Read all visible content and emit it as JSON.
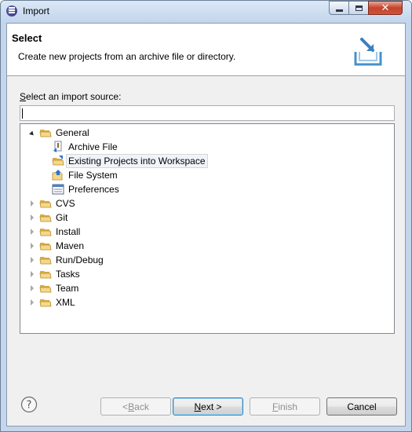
{
  "window": {
    "title": "Import"
  },
  "banner": {
    "title": "Select",
    "description": "Create new projects from an archive file or directory."
  },
  "source": {
    "label_prefix": "S",
    "label_rest": "elect an import source:",
    "filter_value": ""
  },
  "tree": {
    "items": [
      {
        "label": "General",
        "expanded": true,
        "icon": "folder-icon"
      },
      {
        "label": "Archive File",
        "icon": "archive-file-icon"
      },
      {
        "label": "Existing Projects into Workspace",
        "icon": "existing-projects-icon",
        "selected": true
      },
      {
        "label": "File System",
        "icon": "file-system-icon"
      },
      {
        "label": "Preferences",
        "icon": "preferences-icon"
      },
      {
        "label": "CVS",
        "expanded": false,
        "icon": "folder-icon"
      },
      {
        "label": "Git",
        "expanded": false,
        "icon": "folder-icon"
      },
      {
        "label": "Install",
        "expanded": false,
        "icon": "folder-icon"
      },
      {
        "label": "Maven",
        "expanded": false,
        "icon": "folder-icon"
      },
      {
        "label": "Run/Debug",
        "expanded": false,
        "icon": "folder-icon"
      },
      {
        "label": "Tasks",
        "expanded": false,
        "icon": "folder-icon"
      },
      {
        "label": "Team",
        "expanded": false,
        "icon": "folder-icon"
      },
      {
        "label": "XML",
        "expanded": false,
        "icon": "folder-icon"
      }
    ]
  },
  "buttons": {
    "back_mnemonic": "< ",
    "back_ul": "B",
    "back_rest": "ack",
    "next_ul": "N",
    "next_rest": "ext >",
    "finish_ul": "F",
    "finish_rest": "inish",
    "cancel": "Cancel"
  },
  "colors": {
    "titlebar": "#c2d5ec",
    "dialog_bg": "#f0f0f0",
    "close_button": "#c4432b",
    "folder": "#e8c26a"
  }
}
